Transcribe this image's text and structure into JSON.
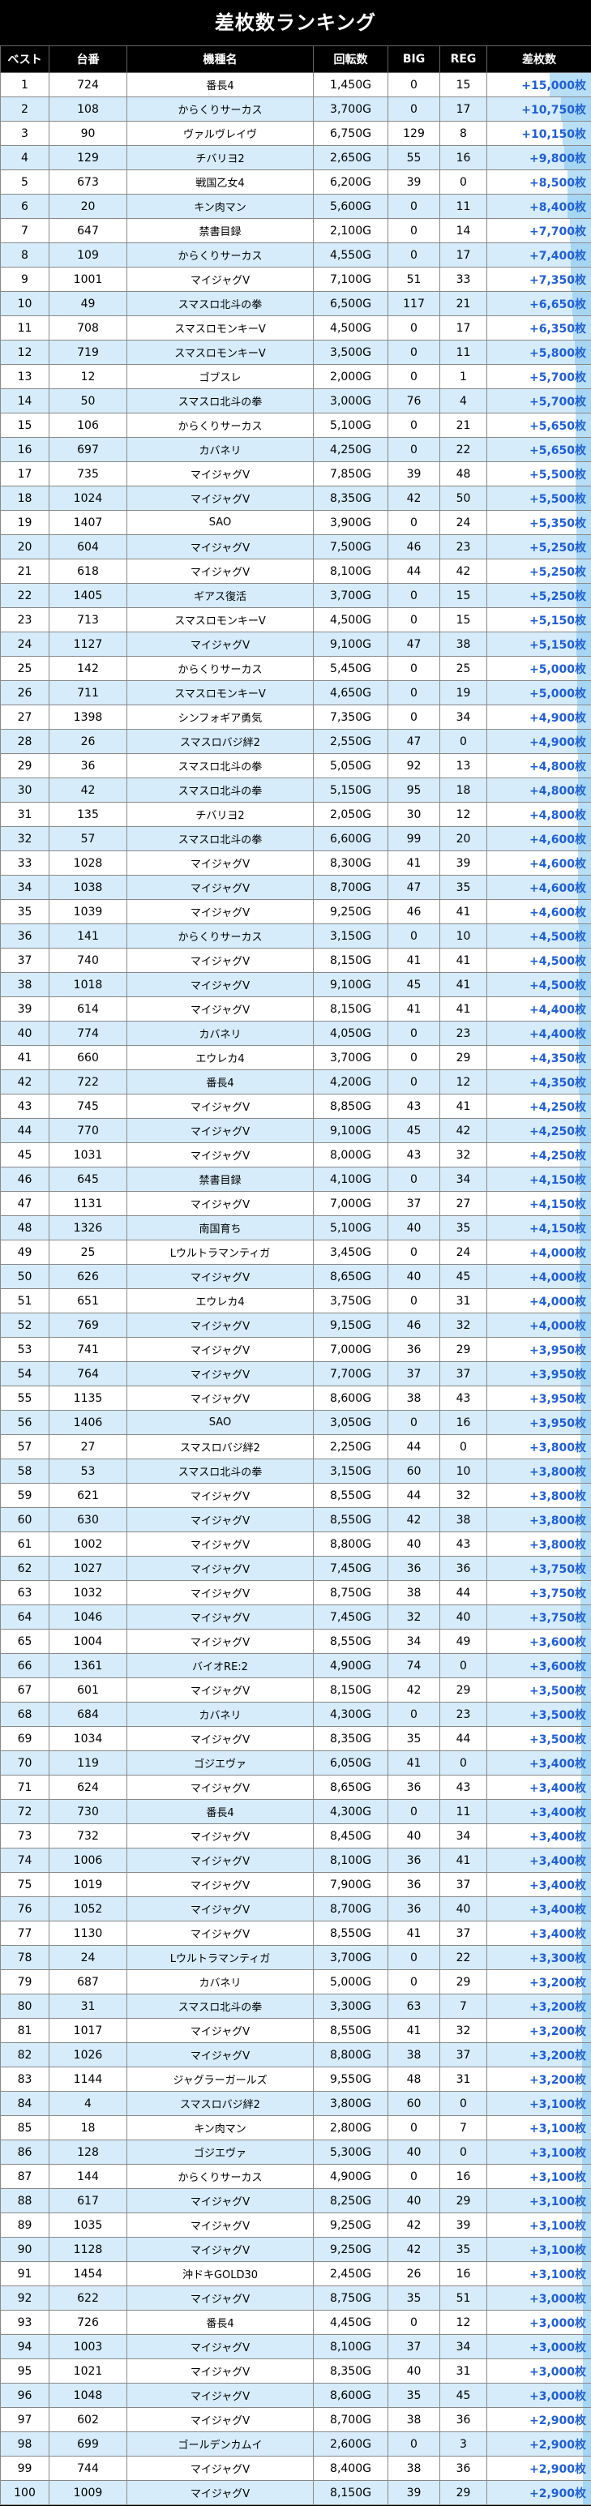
{
  "title": "差枚数ランキング",
  "headers": [
    "ベスト",
    "台番",
    "機種名",
    "回転数",
    "BIG",
    "REG",
    "差枚数"
  ],
  "colors": {
    "header_bg": "#000000",
    "row_odd": "#ffffff",
    "row_even": "#d6ecfb",
    "diff_text": "#1f5fd6",
    "bar": "#7fc4ef"
  },
  "rows": [
    [
      "1",
      "724",
      "番長4",
      "1,450G",
      "0",
      "15",
      "+15,000枚"
    ],
    [
      "2",
      "108",
      "からくりサーカス",
      "3,700G",
      "0",
      "17",
      "+10,750枚"
    ],
    [
      "3",
      "90",
      "ヴァルヴレイヴ",
      "6,750G",
      "129",
      "8",
      "+10,150枚"
    ],
    [
      "4",
      "129",
      "チバリヨ2",
      "2,650G",
      "55",
      "16",
      "+9,800枚"
    ],
    [
      "5",
      "673",
      "戦国乙女4",
      "6,200G",
      "39",
      "0",
      "+8,500枚"
    ],
    [
      "6",
      "20",
      "キン肉マン",
      "5,600G",
      "0",
      "11",
      "+8,400枚"
    ],
    [
      "7",
      "647",
      "禁書目録",
      "2,100G",
      "0",
      "14",
      "+7,700枚"
    ],
    [
      "8",
      "109",
      "からくりサーカス",
      "4,550G",
      "0",
      "17",
      "+7,400枚"
    ],
    [
      "9",
      "1001",
      "マイジャグV",
      "7,100G",
      "51",
      "33",
      "+7,350枚"
    ],
    [
      "10",
      "49",
      "スマスロ北斗の拳",
      "6,500G",
      "117",
      "21",
      "+6,650枚"
    ],
    [
      "11",
      "708",
      "スマスロモンキーV",
      "4,500G",
      "0",
      "17",
      "+6,350枚"
    ],
    [
      "12",
      "719",
      "スマスロモンキーV",
      "3,500G",
      "0",
      "11",
      "+5,800枚"
    ],
    [
      "13",
      "12",
      "ゴブスレ",
      "2,000G",
      "0",
      "1",
      "+5,700枚"
    ],
    [
      "14",
      "50",
      "スマスロ北斗の拳",
      "3,000G",
      "76",
      "4",
      "+5,700枚"
    ],
    [
      "15",
      "106",
      "からくりサーカス",
      "5,100G",
      "0",
      "21",
      "+5,650枚"
    ],
    [
      "16",
      "697",
      "カバネリ",
      "4,250G",
      "0",
      "22",
      "+5,650枚"
    ],
    [
      "17",
      "735",
      "マイジャグV",
      "7,850G",
      "39",
      "48",
      "+5,500枚"
    ],
    [
      "18",
      "1024",
      "マイジャグV",
      "8,350G",
      "42",
      "50",
      "+5,500枚"
    ],
    [
      "19",
      "1407",
      "SAO",
      "3,900G",
      "0",
      "24",
      "+5,350枚"
    ],
    [
      "20",
      "604",
      "マイジャグV",
      "7,500G",
      "46",
      "23",
      "+5,250枚"
    ],
    [
      "21",
      "618",
      "マイジャグV",
      "8,100G",
      "44",
      "42",
      "+5,250枚"
    ],
    [
      "22",
      "1405",
      "ギアス復活",
      "3,700G",
      "0",
      "15",
      "+5,250枚"
    ],
    [
      "23",
      "713",
      "スマスロモンキーV",
      "4,500G",
      "0",
      "15",
      "+5,150枚"
    ],
    [
      "24",
      "1127",
      "マイジャグV",
      "9,100G",
      "47",
      "38",
      "+5,150枚"
    ],
    [
      "25",
      "142",
      "からくりサーカス",
      "5,450G",
      "0",
      "25",
      "+5,000枚"
    ],
    [
      "26",
      "711",
      "スマスロモンキーV",
      "4,650G",
      "0",
      "19",
      "+5,000枚"
    ],
    [
      "27",
      "1398",
      "シンフォギア勇気",
      "7,350G",
      "0",
      "34",
      "+4,900枚"
    ],
    [
      "28",
      "26",
      "スマスロバジ絆2",
      "2,550G",
      "47",
      "0",
      "+4,900枚"
    ],
    [
      "29",
      "36",
      "スマスロ北斗の拳",
      "5,050G",
      "92",
      "13",
      "+4,800枚"
    ],
    [
      "30",
      "42",
      "スマスロ北斗の拳",
      "5,150G",
      "95",
      "18",
      "+4,800枚"
    ],
    [
      "31",
      "135",
      "チバリヨ2",
      "2,050G",
      "30",
      "12",
      "+4,800枚"
    ],
    [
      "32",
      "57",
      "スマスロ北斗の拳",
      "6,600G",
      "99",
      "20",
      "+4,600枚"
    ],
    [
      "33",
      "1028",
      "マイジャグV",
      "8,300G",
      "41",
      "39",
      "+4,600枚"
    ],
    [
      "34",
      "1038",
      "マイジャグV",
      "8,700G",
      "47",
      "35",
      "+4,600枚"
    ],
    [
      "35",
      "1039",
      "マイジャグV",
      "9,250G",
      "46",
      "41",
      "+4,600枚"
    ],
    [
      "36",
      "141",
      "からくりサーカス",
      "3,150G",
      "0",
      "10",
      "+4,500枚"
    ],
    [
      "37",
      "740",
      "マイジャグV",
      "8,150G",
      "41",
      "41",
      "+4,500枚"
    ],
    [
      "38",
      "1018",
      "マイジャグV",
      "9,100G",
      "45",
      "41",
      "+4,500枚"
    ],
    [
      "39",
      "614",
      "マイジャグV",
      "8,150G",
      "41",
      "41",
      "+4,400枚"
    ],
    [
      "40",
      "774",
      "カバネリ",
      "4,050G",
      "0",
      "23",
      "+4,400枚"
    ],
    [
      "41",
      "660",
      "エウレカ4",
      "3,700G",
      "0",
      "29",
      "+4,350枚"
    ],
    [
      "42",
      "722",
      "番長4",
      "4,200G",
      "0",
      "12",
      "+4,350枚"
    ],
    [
      "43",
      "745",
      "マイジャグV",
      "8,850G",
      "43",
      "41",
      "+4,250枚"
    ],
    [
      "44",
      "770",
      "マイジャグV",
      "9,100G",
      "45",
      "42",
      "+4,250枚"
    ],
    [
      "45",
      "1031",
      "マイジャグV",
      "8,000G",
      "43",
      "32",
      "+4,250枚"
    ],
    [
      "46",
      "645",
      "禁書目録",
      "4,100G",
      "0",
      "34",
      "+4,150枚"
    ],
    [
      "47",
      "1131",
      "マイジャグV",
      "7,000G",
      "37",
      "27",
      "+4,150枚"
    ],
    [
      "48",
      "1326",
      "南国育ち",
      "5,100G",
      "40",
      "35",
      "+4,150枚"
    ],
    [
      "49",
      "25",
      "Lウルトラマンティガ",
      "3,450G",
      "0",
      "24",
      "+4,000枚"
    ],
    [
      "50",
      "626",
      "マイジャグV",
      "8,650G",
      "40",
      "45",
      "+4,000枚"
    ],
    [
      "51",
      "651",
      "エウレカ4",
      "3,750G",
      "0",
      "31",
      "+4,000枚"
    ],
    [
      "52",
      "769",
      "マイジャグV",
      "9,150G",
      "46",
      "32",
      "+4,000枚"
    ],
    [
      "53",
      "741",
      "マイジャグV",
      "7,000G",
      "36",
      "29",
      "+3,950枚"
    ],
    [
      "54",
      "764",
      "マイジャグV",
      "7,700G",
      "37",
      "37",
      "+3,950枚"
    ],
    [
      "55",
      "1135",
      "マイジャグV",
      "8,600G",
      "38",
      "43",
      "+3,950枚"
    ],
    [
      "56",
      "1406",
      "SAO",
      "3,050G",
      "0",
      "16",
      "+3,950枚"
    ],
    [
      "57",
      "27",
      "スマスロバジ絆2",
      "2,250G",
      "44",
      "0",
      "+3,800枚"
    ],
    [
      "58",
      "53",
      "スマスロ北斗の拳",
      "3,150G",
      "60",
      "10",
      "+3,800枚"
    ],
    [
      "59",
      "621",
      "マイジャグV",
      "8,550G",
      "44",
      "32",
      "+3,800枚"
    ],
    [
      "60",
      "630",
      "マイジャグV",
      "8,550G",
      "42",
      "38",
      "+3,800枚"
    ],
    [
      "61",
      "1002",
      "マイジャグV",
      "8,800G",
      "40",
      "43",
      "+3,800枚"
    ],
    [
      "62",
      "1027",
      "マイジャグV",
      "7,450G",
      "36",
      "36",
      "+3,750枚"
    ],
    [
      "63",
      "1032",
      "マイジャグV",
      "8,750G",
      "38",
      "44",
      "+3,750枚"
    ],
    [
      "64",
      "1046",
      "マイジャグV",
      "7,450G",
      "32",
      "40",
      "+3,750枚"
    ],
    [
      "65",
      "1004",
      "マイジャグV",
      "8,550G",
      "34",
      "49",
      "+3,600枚"
    ],
    [
      "66",
      "1361",
      "バイオRE:2",
      "4,900G",
      "74",
      "0",
      "+3,600枚"
    ],
    [
      "67",
      "601",
      "マイジャグV",
      "8,150G",
      "42",
      "29",
      "+3,500枚"
    ],
    [
      "68",
      "684",
      "カバネリ",
      "4,300G",
      "0",
      "23",
      "+3,500枚"
    ],
    [
      "69",
      "1034",
      "マイジャグV",
      "8,350G",
      "35",
      "44",
      "+3,500枚"
    ],
    [
      "70",
      "119",
      "ゴジエヴァ",
      "6,050G",
      "41",
      "0",
      "+3,400枚"
    ],
    [
      "71",
      "624",
      "マイジャグV",
      "8,650G",
      "36",
      "43",
      "+3,400枚"
    ],
    [
      "72",
      "730",
      "番長4",
      "4,300G",
      "0",
      "11",
      "+3,400枚"
    ],
    [
      "73",
      "732",
      "マイジャグV",
      "8,450G",
      "40",
      "34",
      "+3,400枚"
    ],
    [
      "74",
      "1006",
      "マイジャグV",
      "8,100G",
      "36",
      "41",
      "+3,400枚"
    ],
    [
      "75",
      "1019",
      "マイジャグV",
      "7,900G",
      "36",
      "37",
      "+3,400枚"
    ],
    [
      "76",
      "1052",
      "マイジャグV",
      "8,700G",
      "36",
      "40",
      "+3,400枚"
    ],
    [
      "77",
      "1130",
      "マイジャグV",
      "8,550G",
      "41",
      "37",
      "+3,400枚"
    ],
    [
      "78",
      "24",
      "Lウルトラマンティガ",
      "3,700G",
      "0",
      "22",
      "+3,300枚"
    ],
    [
      "79",
      "687",
      "カバネリ",
      "5,000G",
      "0",
      "29",
      "+3,200枚"
    ],
    [
      "80",
      "31",
      "スマスロ北斗の拳",
      "3,300G",
      "63",
      "7",
      "+3,200枚"
    ],
    [
      "81",
      "1017",
      "マイジャグV",
      "8,550G",
      "41",
      "32",
      "+3,200枚"
    ],
    [
      "82",
      "1026",
      "マイジャグV",
      "8,800G",
      "38",
      "37",
      "+3,200枚"
    ],
    [
      "83",
      "1144",
      "ジャグラーガールズ",
      "9,550G",
      "48",
      "31",
      "+3,200枚"
    ],
    [
      "84",
      "4",
      "スマスロバジ絆2",
      "3,800G",
      "60",
      "0",
      "+3,100枚"
    ],
    [
      "85",
      "18",
      "キン肉マン",
      "2,800G",
      "0",
      "7",
      "+3,100枚"
    ],
    [
      "86",
      "128",
      "ゴジエヴァ",
      "5,300G",
      "40",
      "0",
      "+3,100枚"
    ],
    [
      "87",
      "144",
      "からくりサーカス",
      "4,900G",
      "0",
      "16",
      "+3,100枚"
    ],
    [
      "88",
      "617",
      "マイジャグV",
      "8,250G",
      "40",
      "29",
      "+3,100枚"
    ],
    [
      "89",
      "1035",
      "マイジャグV",
      "9,250G",
      "42",
      "39",
      "+3,100枚"
    ],
    [
      "90",
      "1128",
      "マイジャグV",
      "9,250G",
      "42",
      "35",
      "+3,100枚"
    ],
    [
      "91",
      "1454",
      "沖ドキGOLD30",
      "2,450G",
      "26",
      "16",
      "+3,100枚"
    ],
    [
      "92",
      "622",
      "マイジャグV",
      "8,750G",
      "35",
      "51",
      "+3,000枚"
    ],
    [
      "93",
      "726",
      "番長4",
      "4,450G",
      "0",
      "12",
      "+3,000枚"
    ],
    [
      "94",
      "1003",
      "マイジャグV",
      "8,100G",
      "37",
      "34",
      "+3,000枚"
    ],
    [
      "95",
      "1021",
      "マイジャグV",
      "8,350G",
      "40",
      "31",
      "+3,000枚"
    ],
    [
      "96",
      "1048",
      "マイジャグV",
      "8,600G",
      "35",
      "45",
      "+3,000枚"
    ],
    [
      "97",
      "602",
      "マイジャグV",
      "8,700G",
      "38",
      "36",
      "+2,900枚"
    ],
    [
      "98",
      "699",
      "ゴールデンカムイ",
      "2,600G",
      "0",
      "3",
      "+2,900枚"
    ],
    [
      "99",
      "744",
      "マイジャグV",
      "8,400G",
      "38",
      "36",
      "+2,900枚"
    ],
    [
      "100",
      "1009",
      "マイジャグV",
      "8,150G",
      "39",
      "29",
      "+2,900枚"
    ]
  ]
}
